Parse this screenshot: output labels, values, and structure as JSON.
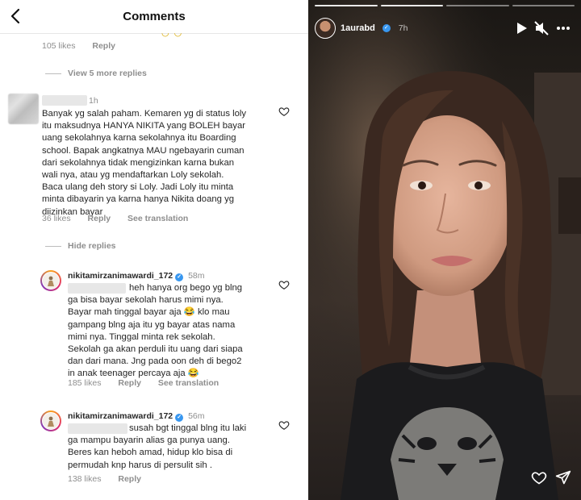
{
  "comments_panel": {
    "title": "Comments",
    "prev_reply": {
      "likes": "105 likes",
      "reply": "Reply"
    },
    "view_more": "View 5 more replies",
    "comment": {
      "time": "1h",
      "text": "Banyak yg salah paham. Kemaren yg di status loly\nitu maksudnya HANYA NIKITA yang BOLEH bayar\nuang sekolahnya karna sekolahnya itu Boarding\nschool. Bapak angkatnya MAU ngebayarin cuman\ndari sekolahnya tidak mengizinkan karna bukan\nwali nya, atau yg mendaftarkan Loly sekolah.\nBaca ulang deh story si Loly. Jadi Loly itu minta\nminta dibayarin ya karna hanya Nikita doang yg\ndiizinkan bayar",
      "likes": "36 likes",
      "reply": "Reply",
      "translate": "See translation"
    },
    "hide_replies": "Hide replies",
    "replies": [
      {
        "username": "nikitamirzanimawardi_172",
        "time": "58m",
        "text": "heh hanya org bego yg blng\nga bisa bayar sekolah harus mimi nya.\nBayar mah tinggal bayar aja 😂 klo mau\ngampang blng aja itu yg bayar atas nama\nmimi nya. Tinggal minta rek sekolah.\nSekolah ga akan perduli itu uang dari siapa\ndan dari mana. Jng pada oon deh di bego2\nin anak teenager percaya aja 😂",
        "likes": "185 likes",
        "reply": "Reply",
        "translate": "See translation"
      },
      {
        "username": "nikitamirzanimawardi_172",
        "time": "56m",
        "text": "susah bgt tinggal blng itu laki\nga mampu bayarin alias ga punya uang.\nBeres kan heboh amad, hidup klo bisa di\npermudah knp harus di persulit sih .",
        "likes": "138 likes",
        "reply": "Reply"
      }
    ]
  },
  "story": {
    "username": "1aurabd",
    "time": "7h",
    "icons": [
      "play-icon",
      "mute-icon",
      "more-icon",
      "heart-icon",
      "share-icon"
    ],
    "colors": {
      "accent": "#3897f0",
      "background": "#2b2520"
    }
  }
}
